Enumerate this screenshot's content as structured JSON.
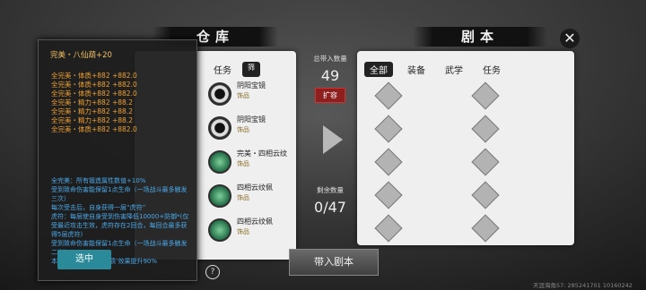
{
  "warehouse": {
    "title": "仓库",
    "tab_partial": "务",
    "filter_icon": "filter-icon"
  },
  "script_panel": {
    "title": "剧本",
    "tabs": [
      {
        "label": "全部",
        "active": true
      },
      {
        "label": "装备",
        "active": false
      },
      {
        "label": "武学",
        "active": false
      },
      {
        "label": "任务",
        "active": false
      }
    ]
  },
  "carry": {
    "total_label": "总带入数量",
    "total_value": "49",
    "expand_label": "扩容",
    "remain_label": "剩余数量",
    "remain_value": "0/47"
  },
  "items": [
    {
      "name": "阴阳宝镜",
      "category": "饰品",
      "icon": "yin-yang-mirror-icon",
      "style": "dark"
    },
    {
      "name": "阴阳宝镜",
      "category": "饰品",
      "icon": "yin-yang-mirror-icon",
      "style": "dark"
    },
    {
      "name": "完美・四相云纹",
      "category": "饰品",
      "icon": "jade-ring-icon",
      "style": "green"
    },
    {
      "name": "四相云纹佩",
      "category": "饰品",
      "icon": "jade-ring-icon",
      "style": "green"
    },
    {
      "name": "四相云纹佩",
      "category": "饰品",
      "icon": "jade-ring-icon",
      "style": "green"
    }
  ],
  "bring_in_label": "带入剧本",
  "tooltip": {
    "title": "完美・八仙葫+20",
    "stats": [
      "全完美・体质+882 +882.0",
      "全完美・体质+882 +882.0",
      "全完美・体质+882 +882.0",
      "全完美・精力+882 +88.2",
      "全完美・精力+882 +88.2",
      "全完美・精力+882 +88.2",
      "全完美・体质+882 +882.0"
    ],
    "effects": [
      "全完美：所有锻造属性数值+10%",
      "受到致命伤害能保留1点生命（一场战斗最多触发三次）",
      "每次受击后，自身获得一层“虎符”",
      "虎符：每层使自身受到伤害降低10000+防御*(仅受最近攻击生效，虎符存在2回合，每回合最多获得5层虎符)",
      "受到致命伤害能保留1点生命（一场战斗最多触发二次）",
      "本装备上锻造属性‘体质’效果提升90%"
    ],
    "select_label": "选中"
  },
  "help_label": "?",
  "close_icon": "close-icon",
  "watermark": "天涯海角57: 285241701  10160242",
  "slots_rows": 5,
  "slots_cols": 2
}
